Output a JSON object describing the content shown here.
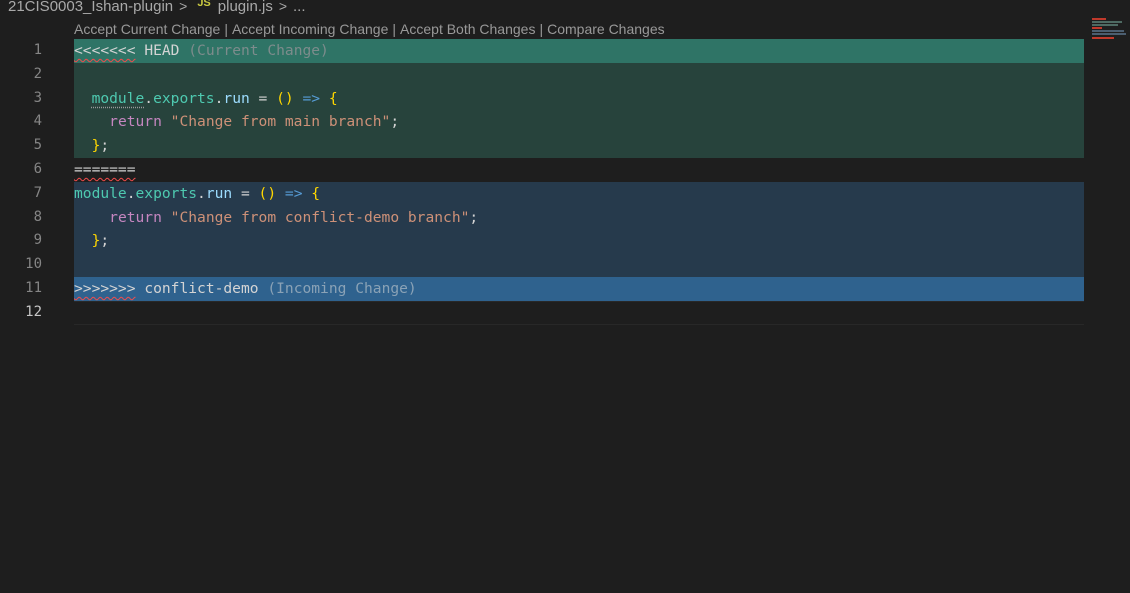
{
  "breadcrumb": {
    "folder": "21CIS0003_Ishan-plugin",
    "sep": ">",
    "file_icon": "JS",
    "file": "plugin.js",
    "more": "..."
  },
  "codelens": {
    "accept_current": "Accept Current Change",
    "accept_incoming": "Accept Incoming Change",
    "accept_both": "Accept Both Changes",
    "compare": "Compare Changes",
    "separator": "|"
  },
  "lines": {
    "l1": {
      "num": "1",
      "marker": "<<<<<<<",
      "label": "HEAD",
      "hint": "(Current Change)"
    },
    "l2": {
      "num": "2"
    },
    "l3": {
      "num": "3",
      "module": "module",
      "dot1": ".",
      "exports": "exports",
      "dot2": ".",
      "run": "run",
      "eq": " = ",
      "parens": "()",
      "arrow": " => ",
      "brace": "{"
    },
    "l4": {
      "num": "4",
      "kw": "return",
      "str": "\"Change from main branch\"",
      "semi": ";"
    },
    "l5": {
      "num": "5",
      "brace": "}",
      "semi": ";"
    },
    "l6": {
      "num": "6",
      "marker": "======="
    },
    "l7": {
      "num": "7",
      "module": "module",
      "dot1": ".",
      "exports": "exports",
      "dot2": ".",
      "run": "run",
      "eq": " = ",
      "parens": "()",
      "arrow": " => ",
      "brace": "{"
    },
    "l8": {
      "num": "8",
      "kw": "return",
      "str": "\"Change from conflict-demo branch\"",
      "semi": ";"
    },
    "l9": {
      "num": "9",
      "brace": "}",
      "semi": ";"
    },
    "l10": {
      "num": "10"
    },
    "l11": {
      "num": "11",
      "marker": ">>>>>>>",
      "label": "conflict-demo",
      "hint": "(Incoming Change)"
    },
    "l12": {
      "num": "12"
    }
  },
  "colors": {
    "current_header": "#2f7466",
    "current_body": "#27433c",
    "incoming_body": "#263a4c",
    "incoming_header": "#2f628e"
  }
}
